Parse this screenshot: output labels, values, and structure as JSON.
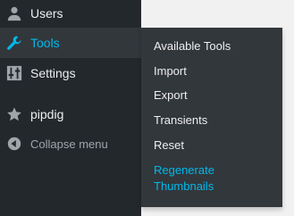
{
  "colors": {
    "sidebar_bg": "#23282d",
    "submenu_bg": "#32373c",
    "text": "#eeeeee",
    "muted": "#a0a5aa",
    "accent": "#00b9eb",
    "page_bg": "#f1f1f1"
  },
  "menu": {
    "users": {
      "label": "Users",
      "icon": "user-icon"
    },
    "tools": {
      "label": "Tools",
      "icon": "wrench-icon"
    },
    "settings": {
      "label": "Settings",
      "icon": "sliders-icon"
    },
    "pipdig": {
      "label": "pipdig",
      "icon": "star-icon"
    },
    "collapse": {
      "label": "Collapse menu",
      "icon": "collapse-arrow-icon"
    }
  },
  "submenu": {
    "items": [
      {
        "label": "Available Tools"
      },
      {
        "label": "Import"
      },
      {
        "label": "Export"
      },
      {
        "label": "Transients"
      },
      {
        "label": "Reset"
      },
      {
        "label": "Regenerate\nThumbnails"
      }
    ]
  }
}
